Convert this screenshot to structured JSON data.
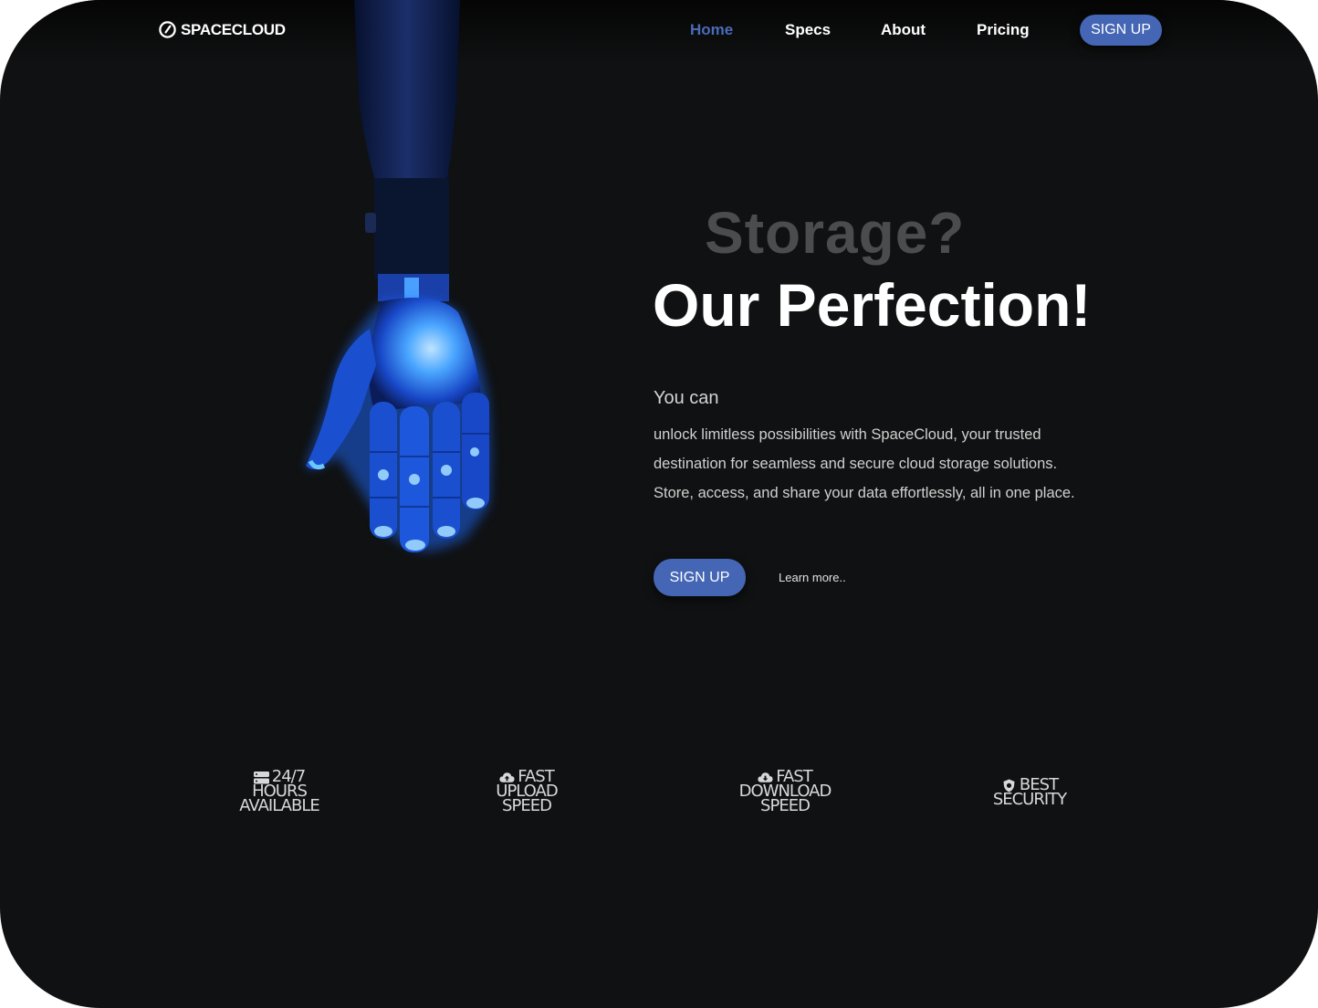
{
  "nav": {
    "logo_text": "SPACECLOUD",
    "links": [
      "Home",
      "Specs",
      "About",
      "Pricing"
    ],
    "active": "Home",
    "signup_label": "SIGN UP"
  },
  "hero": {
    "question": "Storage?",
    "title": "Our Perfection!",
    "subtitle": "You can",
    "description": "unlock limitless possibilities with SpaceCloud, your trusted destination for seamless and secure cloud storage solutions. Store, access, and share your data effortlessly, all in one place.",
    "signup_label": "SIGN UP",
    "learn_more": "Learn more.."
  },
  "features": [
    {
      "icon": "server-icon",
      "line1": "24/7",
      "line2": "HOURS",
      "line3": "AVAILABLE"
    },
    {
      "icon": "cloud-upload-icon",
      "line1": "FAST",
      "line2": "UPLOAD",
      "line3": "SPEED"
    },
    {
      "icon": "cloud-download-icon",
      "line1": "FAST",
      "line2": "DOWNLOAD",
      "line3": "SPEED"
    },
    {
      "icon": "shield-icon",
      "line1": "BEST",
      "line2": "SECURITY"
    }
  ],
  "colors": {
    "background": "#101112",
    "accent": "#4466b4",
    "active_link": "#4a6bb8",
    "glow": "#1e7bff"
  }
}
